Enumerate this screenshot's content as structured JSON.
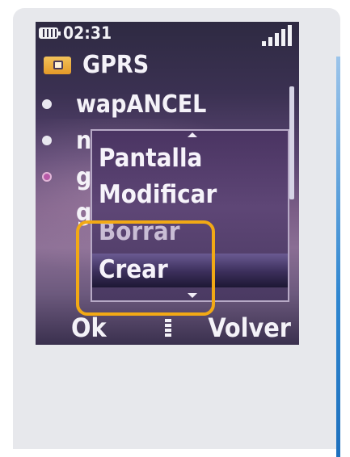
{
  "status": {
    "time": "02:31",
    "battery_icon": "battery-icon",
    "signal_icon": "signal-bars-icon"
  },
  "header": {
    "title": "GPRS",
    "icon": "folder-icon"
  },
  "list": {
    "items": [
      {
        "label": "wapANCEL"
      },
      {
        "label": "n"
      },
      {
        "label": "g"
      },
      {
        "label": "g"
      }
    ]
  },
  "popup_menu": {
    "items": [
      {
        "label": "Pantalla"
      },
      {
        "label": "Modificar"
      },
      {
        "label": "Borrar"
      },
      {
        "label": "Crear"
      }
    ],
    "selected": "Crear"
  },
  "softkeys": {
    "left": "Ok",
    "right": "Volver"
  },
  "colors": {
    "highlight_callout": "#f2a915",
    "frame_accent": "#2f86d0"
  }
}
